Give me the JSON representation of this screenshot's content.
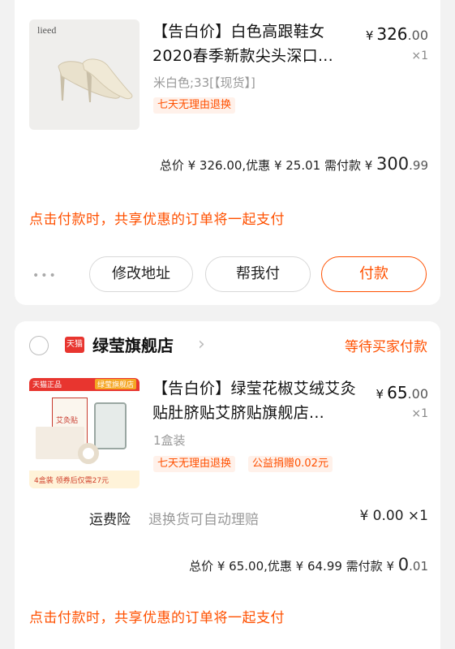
{
  "order1": {
    "product": {
      "title": "【告白价】白色高跟鞋女2020春季新款尖头深口...",
      "brand_logo": "lieed",
      "spec": "米白色;33[【现货】]",
      "tag": "七天无理由退换",
      "price_currency": "¥",
      "price_int": "326",
      "price_dec": ".00",
      "qty": "×1"
    },
    "summary": {
      "text": "总价 ¥ 326.00,优惠 ¥ 25.01 需付款 ¥ ",
      "pay_int": "300",
      "pay_dec": ".99"
    },
    "notice": "点击付款时，共享优惠的订单将一起支付",
    "more": "•••",
    "buttons": {
      "modify": "修改地址",
      "help": "帮我付",
      "pay": "付款"
    }
  },
  "order2": {
    "shop": {
      "badge": "天猫",
      "name": "绿莹旗舰店",
      "chevron": "›",
      "status": "等待买家付款"
    },
    "product": {
      "title": "【告白价】绿莹花椒艾绒艾灸贴肚脐贴艾脐贴旗舰店...",
      "spec": "1盒装",
      "tag1": "七天无理由退换",
      "tag2": "公益捐赠0.02元",
      "price_currency": "¥",
      "price_int": "65",
      "price_dec": ".00",
      "qty": "×1",
      "thumb_banner_left": "天猫正品",
      "thumb_banner_right": "绿莹旗舰店",
      "thumb_box_label": "艾灸贴",
      "thumb_bottom": "4盒装 领券后仅需27元"
    },
    "insurance": {
      "label": "运费险",
      "desc": "退换货可自动理赔",
      "price": "¥ 0.00 ×1"
    },
    "summary": {
      "text": "总价 ¥ 65.00,优惠 ¥ 64.99 需付款 ¥ ",
      "pay_int": "0",
      "pay_dec": ".01"
    },
    "notice": "点击付款时，共享优惠的订单将一起支付"
  },
  "colors": {
    "accent": "#ff5000",
    "background": "#f2f2f2",
    "card": "#ffffff",
    "tmall_red": "#e8352f"
  }
}
